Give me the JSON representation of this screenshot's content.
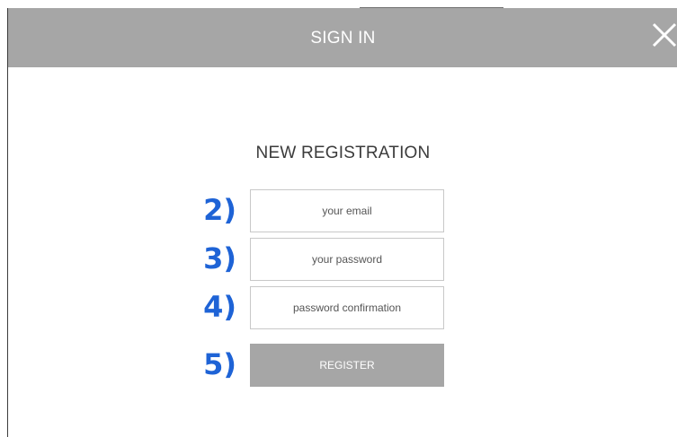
{
  "dialog": {
    "title": "SIGN IN",
    "close_icon": "close-x-icon"
  },
  "form": {
    "heading": "NEW REGISTRATION",
    "email": {
      "value": "",
      "placeholder": "your email"
    },
    "password": {
      "value": "",
      "placeholder": "your password"
    },
    "password_confirmation": {
      "value": "",
      "placeholder": "password confirmation"
    },
    "register_label": "REGISTER"
  },
  "annotations": [
    "2)",
    "3)",
    "4)",
    "5)"
  ],
  "colors": {
    "header": "#a6a6a6",
    "button": "#a6a6a6",
    "annotation": "#1e63d6",
    "input_border": "#c8c8c8"
  }
}
